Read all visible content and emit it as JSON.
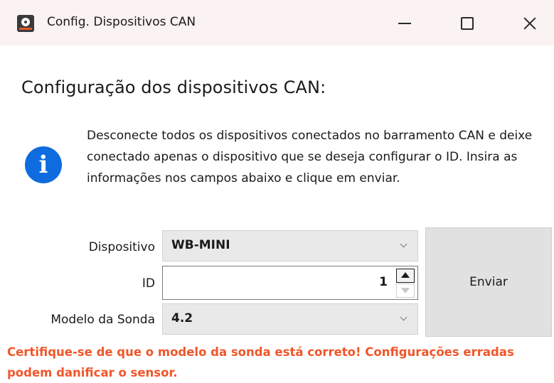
{
  "window": {
    "title": "Config. Dispositivos CAN",
    "app_icon": "app-logo-icon",
    "controls": {
      "minimize_icon": "minimize-icon",
      "maximize_icon": "maximize-icon",
      "close_icon": "close-icon"
    }
  },
  "heading": "Configuração dos dispositivos CAN:",
  "info": {
    "icon": "info-icon",
    "icon_glyph": "i",
    "icon_color": "#0f6cde",
    "text": "Desconecte todos os dispositivos conectados no barramento CAN e deixe conectado apenas o dispositivo que se deseja configurar o ID. Insira as informações nos campos abaixo e clique em enviar."
  },
  "form": {
    "dispositivo": {
      "label": "Dispositivo",
      "value": "WB-MINI"
    },
    "id": {
      "label": "ID",
      "value": "1"
    },
    "modelo_sonda": {
      "label": "Modelo da Sonda",
      "value": "4.2"
    }
  },
  "actions": {
    "send_label": "Enviar"
  },
  "warning": {
    "text": "Certifique-se de que o modelo da sonda está correto! Configurações erradas podem danificar o sensor.",
    "color": "#f0562a"
  },
  "colors": {
    "titlebar_bg": "#fbf2f2",
    "button_bg": "#e1e1e1"
  }
}
